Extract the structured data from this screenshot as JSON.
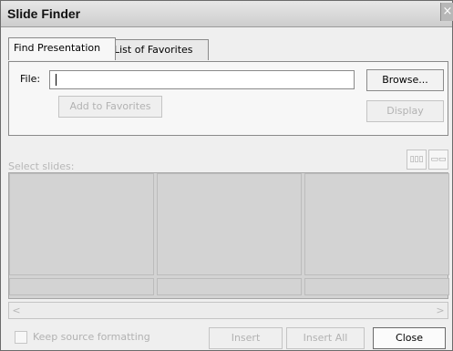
{
  "window": {
    "title": "Slide Finder",
    "close_glyph": "×"
  },
  "tabs": [
    {
      "label": "Find Presentation",
      "active": true
    },
    {
      "label": "List of Favorites",
      "active": false
    }
  ],
  "file": {
    "label": "File:",
    "value": ""
  },
  "buttons": {
    "browse": "Browse...",
    "add_to_favorites": "Add to Favorites",
    "display": "Display",
    "insert": "Insert",
    "insert_all": "Insert All",
    "close": "Close"
  },
  "select_slides_label": "Select slides:",
  "view_buttons": [
    {
      "icon": "thumbnail-view-icon"
    },
    {
      "icon": "list-view-icon"
    }
  ],
  "slides": [
    {
      "label": ""
    },
    {
      "label": ""
    },
    {
      "label": ""
    }
  ],
  "scrollbar": {
    "left": "<",
    "right": ">"
  },
  "keep_source_formatting": {
    "label": "Keep source formatting",
    "checked": false
  }
}
